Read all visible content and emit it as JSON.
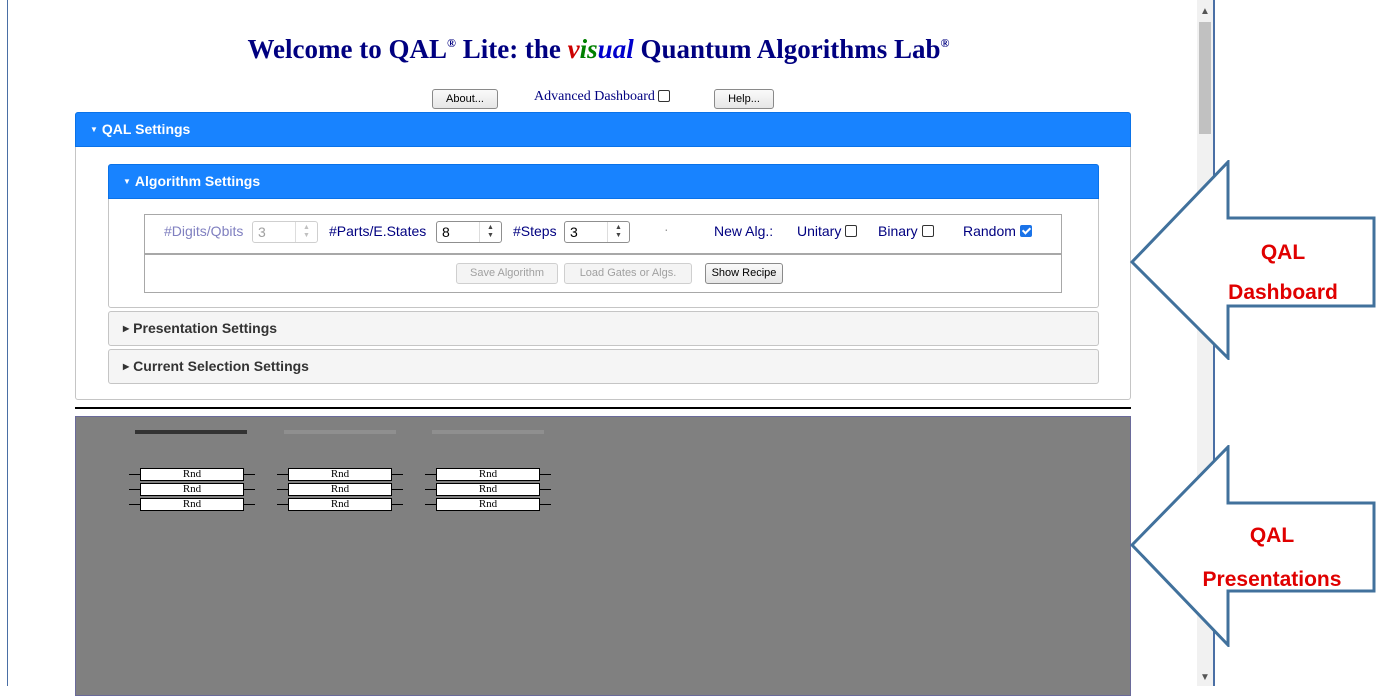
{
  "title": {
    "part1": "Welcome to QAL",
    "reg1": "®",
    "part2": " Lite: the ",
    "visual_v": "v",
    "visual_is": "is",
    "visual_ual": "ual",
    "part3": " Quantum Algorithms Lab",
    "reg2": "®"
  },
  "toolbar": {
    "about_label": "About...",
    "advanced_label": "Advanced Dashboard",
    "help_label": "Help..."
  },
  "qal_settings": {
    "header": "QAL Settings"
  },
  "algorithm_settings": {
    "header": "Algorithm Settings",
    "digits_label": "#Digits/Qbits",
    "digits_value": "3",
    "parts_label": "#Parts/E.States",
    "parts_value": "8",
    "steps_label": "#Steps",
    "steps_value": "3",
    "dot": "·",
    "new_alg_label": "New Alg.:",
    "unitary_label": "Unitary",
    "binary_label": "Binary",
    "random_label": "Random",
    "save_label": "Save Algorithm",
    "load_label": "Load Gates or Algs.",
    "recipe_label": "Show Recipe"
  },
  "presentation_settings": {
    "header": "Presentation Settings"
  },
  "current_selection_settings": {
    "header": "Current Selection Settings"
  },
  "circuit": {
    "columns": [
      [
        "Rnd",
        "Rnd",
        "Rnd"
      ],
      [
        "Rnd",
        "Rnd",
        "Rnd"
      ],
      [
        "Rnd",
        "Rnd",
        "Rnd"
      ]
    ]
  },
  "callouts": {
    "dashboard_line1": "QAL",
    "dashboard_line2": "Dashboard",
    "presentations_line1": "QAL",
    "presentations_line2": "Presentations"
  },
  "colors": {
    "header_blue": "#1883ff",
    "title_navy": "#000080",
    "callout_red": "#e00000",
    "arrow_outline": "#41719c",
    "presentation_gray": "#808080"
  }
}
